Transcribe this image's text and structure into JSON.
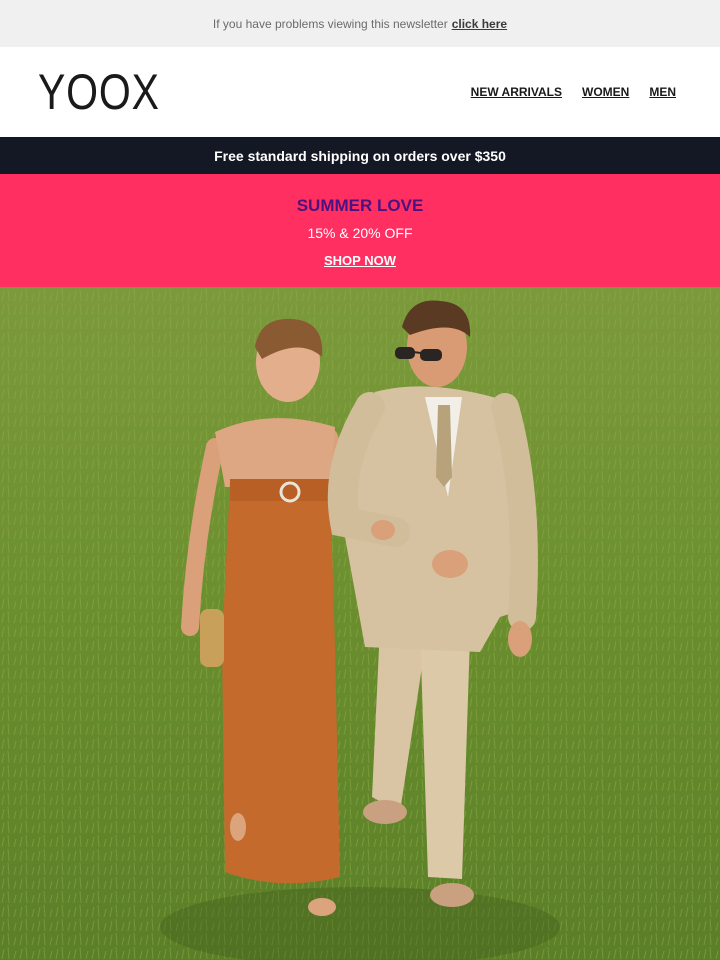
{
  "preheader": {
    "text": "If you have problems viewing this newsletter",
    "link_label": "click here"
  },
  "header": {
    "logo": "YOOX",
    "nav": [
      {
        "label": "NEW ARRIVALS"
      },
      {
        "label": "WOMEN"
      },
      {
        "label": "MEN"
      }
    ]
  },
  "shipping_bar": {
    "text": "Free standard shipping on orders over $350"
  },
  "promo": {
    "title": "SUMMER LOVE",
    "subtitle": "15% & 20% OFF",
    "cta": "SHOP NOW",
    "colors": {
      "background": "#ff2f62",
      "title": "#4a1380"
    }
  },
  "hero_image": {
    "subject": "couple-walking-in-grass-field"
  }
}
